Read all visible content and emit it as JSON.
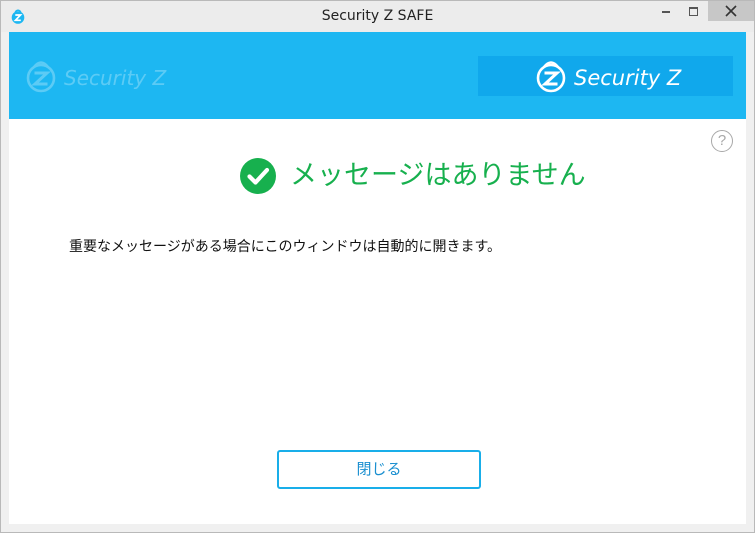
{
  "window": {
    "title": "Security Z SAFE",
    "controls": {
      "minimize": "minimize-icon",
      "maximize": "maximize-icon",
      "close": "close-icon"
    }
  },
  "banner": {
    "watermark_text": "Security Z",
    "logo_text": "Security Z",
    "background_color": "#1db7f2",
    "logo_box_color": "#10a8ec"
  },
  "content": {
    "help_icon": "?",
    "status_icon": "check-circle-icon",
    "status_color": "#17b04e",
    "status_text": "メッセージはありません",
    "description": "重要なメッセージがある場合にこのウィンドウは自動的に開きます。",
    "close_button_label": "閉じる"
  }
}
